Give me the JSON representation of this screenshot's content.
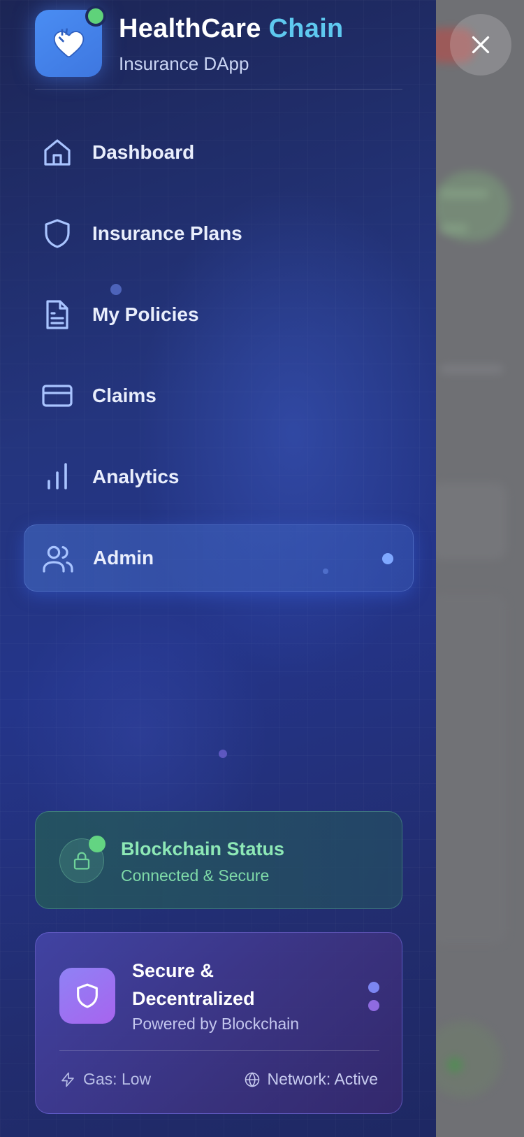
{
  "app": {
    "title_main": "HealthCare",
    "title_accent": "Chain",
    "subtitle": "Insurance DApp"
  },
  "nav": {
    "items": [
      {
        "label": "Dashboard",
        "icon": "home-icon"
      },
      {
        "label": "Insurance Plans",
        "icon": "shield-icon"
      },
      {
        "label": "My Policies",
        "icon": "document-icon"
      },
      {
        "label": "Claims",
        "icon": "credit-card-icon"
      },
      {
        "label": "Analytics",
        "icon": "bar-chart-icon"
      },
      {
        "label": "Admin",
        "icon": "users-icon",
        "active": true
      }
    ]
  },
  "status": {
    "title": "Blockchain Status",
    "subtitle": "Connected & Secure",
    "icon": "lock-icon"
  },
  "secure": {
    "title": "Secure & Decentralized",
    "subtitle": "Powered by Blockchain",
    "gas": "Gas: Low",
    "network": "Network: Active"
  },
  "colors": {
    "accent": "#5ec8ef",
    "online": "#5fd27a",
    "status_text": "#8de8b6",
    "secure_tile": "#a764ee"
  }
}
